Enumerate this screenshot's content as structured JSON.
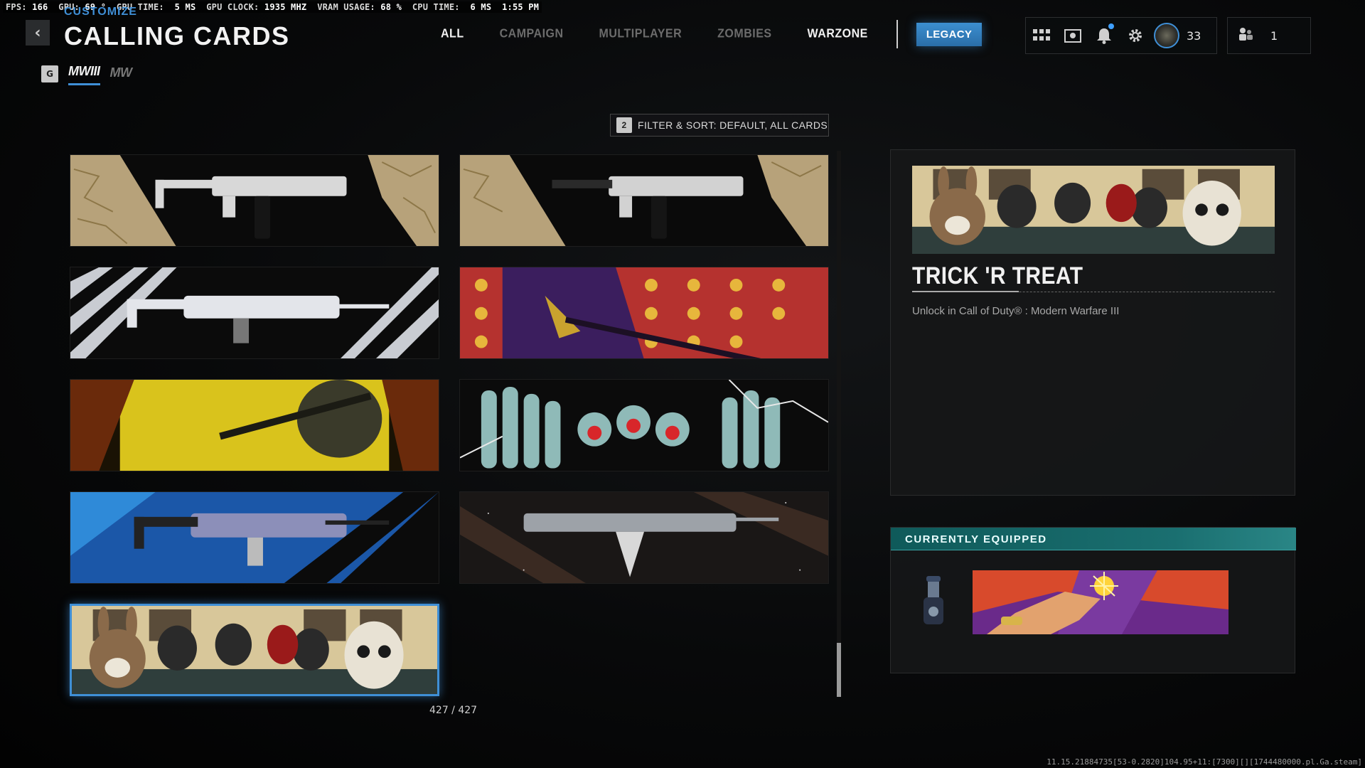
{
  "perf_overlay": {
    "fps_label": "FPS:",
    "fps": "166",
    "gpu_label": "GPU:",
    "gpu": "69 °",
    "gpu_time_label": "GPU TIME:",
    "gpu_time": "5 MS",
    "gpu_clock_label": "GPU CLOCK:",
    "gpu_clock": "1935 MHZ",
    "vram_label": "VRAM USAGE:",
    "vram": "68 %",
    "cpu_time_label": "CPU TIME:",
    "cpu_time": "6 MS",
    "clock": "1:55 PM"
  },
  "header": {
    "breadcrumb": "CUSTOMIZE",
    "title": "CALLING CARDS",
    "back_icon": "chevron-left-icon"
  },
  "sub_tabs": {
    "key": "G",
    "items": [
      {
        "label": "MWIII",
        "active": true
      },
      {
        "label": "MW",
        "active": false
      }
    ]
  },
  "main_tabs": {
    "items": [
      {
        "label": "ALL",
        "active": true
      },
      {
        "label": "CAMPAIGN",
        "active": false
      },
      {
        "label": "MULTIPLAYER",
        "active": false
      },
      {
        "label": "ZOMBIES",
        "active": false
      },
      {
        "label": "WARZONE",
        "active": true
      }
    ],
    "legacy": "LEGACY"
  },
  "hud": {
    "icons": [
      "grid-menu-icon",
      "store-icon",
      "bell-icon",
      "gear-icon"
    ],
    "level": "33",
    "party_count": "1",
    "accent": "#3f8fd6"
  },
  "filter": {
    "key": "2",
    "label": "FILTER & SORT: DEFAULT, ALL CARDS"
  },
  "cards": [
    {
      "name": "gold-circuit-smg-left"
    },
    {
      "name": "gold-circuit-smg-right"
    },
    {
      "name": "chrome-rifle"
    },
    {
      "name": "skull-pattern-sniper"
    },
    {
      "name": "yellow-hex-soldier"
    },
    {
      "name": "skeleton-hands"
    },
    {
      "name": "blue-crystal-rifle"
    },
    {
      "name": "cosmic-serrated-rifle"
    },
    {
      "name": "trick-r-treat",
      "selected": true
    }
  ],
  "counter": "427 / 427",
  "scroll": {
    "position_fraction": 0.9
  },
  "detail": {
    "title": "TRICK 'R TREAT",
    "description": "Unlock in Call of Duty® : Modern Warfare III"
  },
  "equipped": {
    "header": "CURRENTLY EQUIPPED"
  },
  "build_string": "11.15.21884735[53-0.2820]104.95+11:[7300][][1744480000.pl.Ga.steam]"
}
